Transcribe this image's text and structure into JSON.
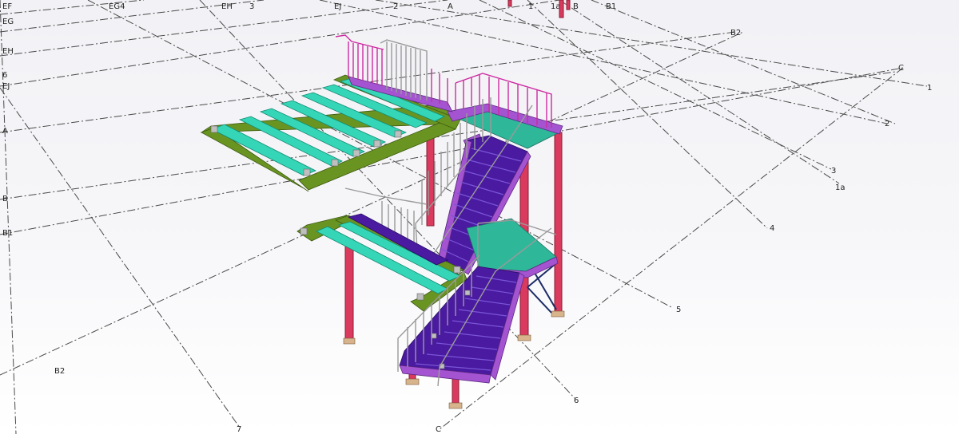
{
  "viewport": {
    "gridlines": {
      "top_labels": [
        "EF",
        "EG4",
        "EH",
        "3",
        "EJ",
        "2",
        "A",
        "1",
        "1a",
        "B",
        "B1"
      ],
      "left_labels": [
        "EG",
        "EH",
        "6",
        "EJ",
        "A",
        "B",
        "B1",
        "B2"
      ],
      "right_labels": [
        "B2",
        "C",
        "1",
        "2",
        "3",
        "1a",
        "4",
        "5",
        "6"
      ],
      "bottom_labels": [
        "7",
        "C"
      ]
    },
    "colors": {
      "columns": "#d93a5d",
      "floor_beams": "#6a9422",
      "joists": "#35d6b7",
      "landings": "#2fb79a",
      "stair_flights": "#4a1aa0",
      "stringers": "#a454d0",
      "handrails_magenta": "#cc2aa0",
      "handrails_grey": "#9a9a9a",
      "bracing": "#1a2a66"
    }
  }
}
